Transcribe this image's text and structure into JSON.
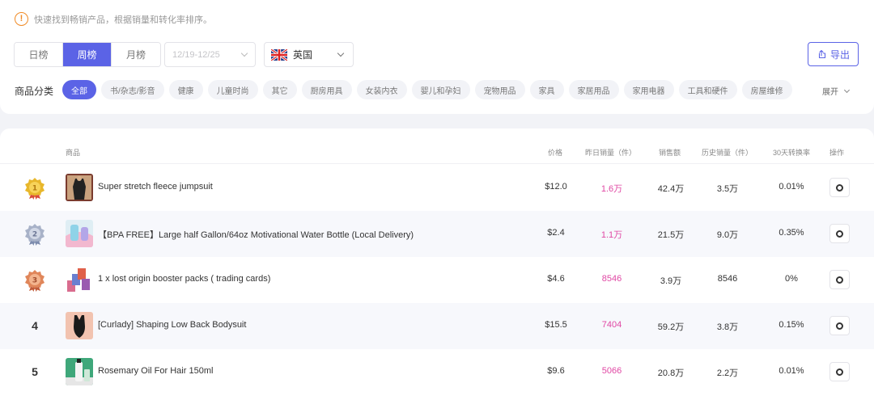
{
  "tip": {
    "text": "快速找到畅销产品，根据销量和转化率排序。"
  },
  "period_tabs": [
    {
      "label": "日榜",
      "active": false
    },
    {
      "label": "周榜",
      "active": true
    },
    {
      "label": "月榜",
      "active": false
    }
  ],
  "date_range": {
    "value": "12/19-12/25"
  },
  "country": {
    "label": "英国",
    "flag_icon": "uk-flag-icon"
  },
  "export": {
    "label": "导出"
  },
  "categories": {
    "label": "商品分类",
    "items": [
      "全部",
      "书/杂志/影音",
      "健康",
      "儿童时尚",
      "其它",
      "厨房用具",
      "女装内衣",
      "婴儿和孕妇",
      "宠物用品",
      "家具",
      "家居用品",
      "家用电器",
      "工具和硬件",
      "房屋维修"
    ],
    "expand_label": "展开"
  },
  "table": {
    "headers": {
      "product": "商品",
      "price": "价格",
      "yesterday_sales": "昨日销量（件）",
      "revenue": "销售额",
      "total_sales": "历史销量（件）",
      "conversion": "30天转换率",
      "action": "操作"
    },
    "rows": [
      {
        "rank": "1",
        "name": "Super stretch fleece jumpsuit",
        "price": "$12.0",
        "yesterday_sales": "1.6万",
        "revenue": "42.4万",
        "total_sales": "3.5万",
        "conversion": "0.01%"
      },
      {
        "rank": "2",
        "name": "【BPA FREE】Large half Gallon/64oz Motivational Water Bottle (Local Delivery)",
        "price": "$2.4",
        "yesterday_sales": "1.1万",
        "revenue": "21.5万",
        "total_sales": "9.0万",
        "conversion": "0.35%"
      },
      {
        "rank": "3",
        "name": "1 x lost origin booster packs ( trading cards)",
        "price": "$4.6",
        "yesterday_sales": "8546",
        "revenue": "3.9万",
        "total_sales": "8546",
        "conversion": "0%"
      },
      {
        "rank": "4",
        "name": "[Curlady] Shaping Low Back Bodysuit",
        "price": "$15.5",
        "yesterday_sales": "7404",
        "revenue": "59.2万",
        "total_sales": "3.8万",
        "conversion": "0.15%"
      },
      {
        "rank": "5",
        "name": "Rosemary Oil For Hair 150ml",
        "price": "$9.6",
        "yesterday_sales": "5066",
        "revenue": "20.8万",
        "total_sales": "2.2万",
        "conversion": "0.01%"
      }
    ]
  },
  "colors": {
    "accent": "#5b63e6",
    "sales_pink": "#e048a4",
    "warning": "#f08a24",
    "gold": "#e8b72c",
    "silver": "#a8b2c8",
    "bronze": "#e0865a"
  }
}
